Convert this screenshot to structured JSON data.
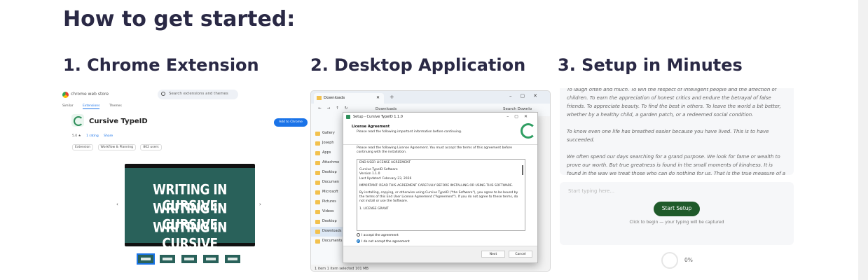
{
  "heading": "How to get started:",
  "steps": [
    {
      "title": "1. Chrome Extension"
    },
    {
      "title": "2. Desktop Application"
    },
    {
      "title": "3. Setup in Minutes"
    }
  ],
  "chrome_panel": {
    "store_name": "chrome web store",
    "search_placeholder": "Search extensions and themes",
    "tabs": [
      "Similar",
      "Extensions",
      "Themes"
    ],
    "extension_name": "Cursive TypeID",
    "add_button": "Add to Chrome",
    "rating": "5.0 ★",
    "rating_link": "1 rating",
    "share": "Share",
    "chips": [
      "Extension",
      "Workflow & Planning",
      "802 users"
    ],
    "banner_lines": [
      "WRITING IN CURSIVE",
      "WRITING IN CURSIVE",
      "WRITING IN CURSIVE"
    ],
    "prev_arrow": "‹",
    "next_arrow": "›"
  },
  "desktop_panel": {
    "tab_title": "Downloads",
    "breadcrumb": "Downloads",
    "search_placeholder": "Search Downlo",
    "sidebar_items": [
      "Gallery",
      "Joseph",
      "Apps",
      "Attachme",
      "Desktop",
      "Documen",
      "Microsoft",
      "Pictures",
      "Videos",
      "Desktop",
      "Downloads",
      "Documents"
    ],
    "status": "1 item   1 item selected  101 MB",
    "dialog": {
      "title": "Setup - Cursive TypeID 1.1.0",
      "heading": "License Agreement",
      "subheading": "Please read the following important information before continuing.",
      "intro": "Please read the following License Agreement. You must accept the terms of this agreement before continuing with the installation.",
      "license_lines": [
        "END USER LICENSE AGREEMENT",
        "Cursive TypeID Software\nVersion 1.1.0\nLast Updated: February 23, 2026",
        "IMPORTANT: READ THIS AGREEMENT CAREFULLY BEFORE INSTALLING OR USING THIS SOFTWARE.",
        "By installing, copying, or otherwise using Cursive TypeID (\"the Software\"), you agree to be bound by the terms of this End User License Agreement (\"Agreement\"). If you do not agree to these terms, do not install or use the Software.",
        "1. LICENSE GRANT"
      ],
      "accept": "I accept the agreement",
      "decline": "I do not accept the agreement",
      "next": "Next",
      "cancel": "Cancel"
    }
  },
  "setup_panel": {
    "quote_paragraphs": [
      "To laugh often and much. To win the respect of intelligent people and the affection of children. To earn the appreciation of honest critics and endure the betrayal of false friends. To appreciate beauty. To find the best in others. To leave the world a bit better, whether by a healthy child, a garden patch, or a redeemed social condition.",
      "To know even one life has breathed easier because you have lived. This is to have succeeded.",
      "We often spend our days searching for a grand purpose. We look for fame or wealth to prove our worth. But true greatness is found in the small moments of kindness. It is found in the way we treat those who can do nothing for us. That is the true measure of a life well lived."
    ],
    "input_placeholder": "Start typing here...",
    "start_button": "Start Setup",
    "hint": "Click to begin — your typing will be captured",
    "progress": "0%"
  }
}
